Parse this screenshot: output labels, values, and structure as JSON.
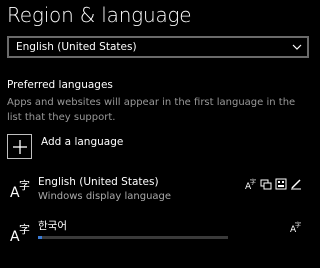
{
  "header": {
    "title": "Region & language"
  },
  "country_select": {
    "value": "English (United States)"
  },
  "preferred": {
    "heading": "Preferred languages",
    "description": "Apps and websites will appear in the first language in the list that they support."
  },
  "add_language": {
    "label": "Add a language"
  },
  "languages": [
    {
      "name": "English (United States)",
      "subtitle": "Windows display language",
      "icon": "language-icon",
      "features": [
        "text-to-speech-icon",
        "display-language-icon",
        "keyboard-icon",
        "handwriting-icon"
      ]
    },
    {
      "name": "한국어",
      "icon": "language-icon",
      "features": [
        "text-to-speech-icon"
      ],
      "download_progress": 0.02
    }
  ],
  "colors": {
    "accent": "#3a7bd5",
    "background": "#000000",
    "secondary_text": "#999999"
  }
}
